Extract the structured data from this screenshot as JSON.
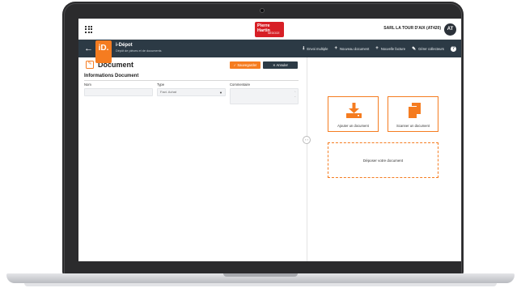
{
  "app": {
    "brand_line1": "Pierre",
    "brand_line2": "Hartin",
    "brand_line3": "NEGOCE",
    "company": "SARL LA TOUR D'AIX (AT420)",
    "user_initials": "AT",
    "logo_text": "iD.",
    "title": "i-Dépot",
    "subtitle": "Dépôt de pièces et de documents"
  },
  "nav": {
    "items": [
      {
        "label": "Envoi multiple",
        "icon": "upload-icon"
      },
      {
        "label": "Nouveau document",
        "icon": "plus-icon"
      },
      {
        "label": "Nouvelle facture",
        "icon": "plus-icon"
      },
      {
        "label": "Gérer collecteurs",
        "icon": "edit-icon"
      }
    ],
    "help_label": "?"
  },
  "document": {
    "title": "Document",
    "save_label": "✓ Sauvegarder",
    "cancel_label": "✕ Annuler",
    "section_title": "Informations Document",
    "fields": {
      "nom_label": "Nom",
      "nom_value": "",
      "type_label": "Type",
      "type_value": "Fact. Achat",
      "commentaire_label": "Commentaire",
      "commentaire_value": ""
    }
  },
  "panel": {
    "add_label": "Ajouter un document",
    "scan_label": "Scanner un document",
    "drop_label": "Déposer votre document",
    "toggle_label": "‹ ›"
  },
  "colors": {
    "accent": "#f57c20",
    "navbar": "#2c3a45",
    "brand_red": "#d71f26"
  }
}
